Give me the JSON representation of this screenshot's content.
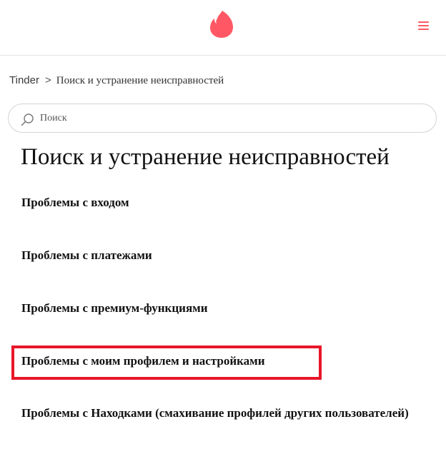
{
  "header": {
    "logo_icon": "tinder-flame-icon",
    "menu_icon": "hamburger-menu-icon",
    "accent_color": "#ff5864"
  },
  "breadcrumb": {
    "home": "Tinder",
    "separator": ">",
    "current": "Поиск и устранение неисправностей"
  },
  "search": {
    "icon": "search-icon",
    "placeholder": "Поиск",
    "value": ""
  },
  "main": {
    "title": "Поиск и устранение неисправностей",
    "topics": [
      {
        "label": "Проблемы с входом"
      },
      {
        "label": "Проблемы с платежами"
      },
      {
        "label": "Проблемы с премиум-функциями"
      },
      {
        "label": "Проблемы с моим профилем и настройками",
        "highlighted": true
      },
      {
        "label": "Проблемы с Находками (смахивание профилей других пользователей)"
      }
    ],
    "highlight_color": "#e8162a"
  }
}
